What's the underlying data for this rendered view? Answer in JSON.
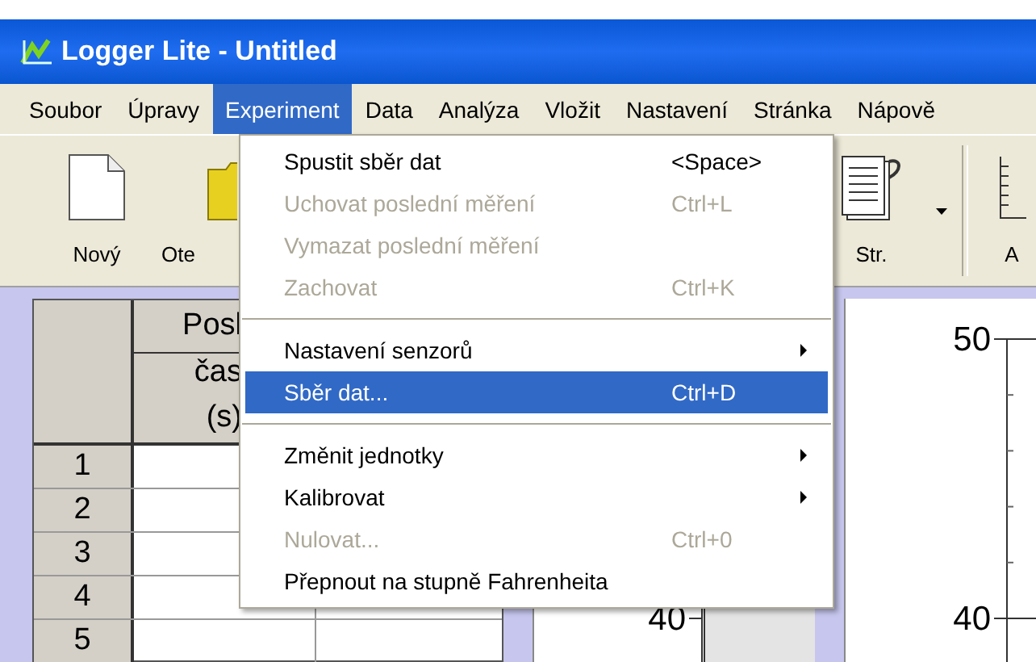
{
  "window": {
    "title": "Logger Lite - Untitled"
  },
  "menu_bar": [
    {
      "label": "Soubor",
      "selected": false
    },
    {
      "label": "Úpravy",
      "selected": false
    },
    {
      "label": "Experiment",
      "selected": true
    },
    {
      "label": "Data",
      "selected": false
    },
    {
      "label": "Analýza",
      "selected": false
    },
    {
      "label": "Vložit",
      "selected": false
    },
    {
      "label": "Nastavení",
      "selected": false
    },
    {
      "label": "Stránka",
      "selected": false
    },
    {
      "label": "Nápově",
      "selected": false
    }
  ],
  "toolbar": [
    {
      "label": "Nový",
      "has_dropdown": false
    },
    {
      "label": "Ote",
      "has_dropdown": false
    },
    {
      "label": "Str.",
      "has_dropdown": true
    },
    {
      "label": "A",
      "has_dropdown": false
    }
  ],
  "table": {
    "column_group": "Posl",
    "column": "čas",
    "unit": "(s)",
    "rows": [
      "1",
      "2",
      "3",
      "4",
      "5"
    ]
  },
  "graphs": [
    {
      "ticks": [
        "40"
      ]
    },
    {
      "ticks": [
        "50",
        "40"
      ]
    }
  ],
  "menu": [
    {
      "kind": "item",
      "label": "Spustit sběr dat",
      "shortcut": "<Space>",
      "disabled": false,
      "selected": false,
      "submenu": false
    },
    {
      "kind": "item",
      "label": "Uchovat poslední měření",
      "shortcut": "Ctrl+L",
      "disabled": true,
      "selected": false,
      "submenu": false
    },
    {
      "kind": "item",
      "label": "Vymazat poslední měření",
      "disabled": true,
      "selected": false,
      "submenu": false
    },
    {
      "kind": "item",
      "label": "Zachovat",
      "shortcut": "Ctrl+K",
      "disabled": true,
      "selected": false,
      "submenu": false
    },
    {
      "kind": "separator"
    },
    {
      "kind": "item",
      "label": "Nastavení senzorů",
      "disabled": false,
      "selected": false,
      "submenu": true
    },
    {
      "kind": "item",
      "label": "Sběr dat...",
      "shortcut": "Ctrl+D",
      "disabled": false,
      "selected": true,
      "submenu": false
    },
    {
      "kind": "separator"
    },
    {
      "kind": "item",
      "label": "Změnit jednotky",
      "disabled": false,
      "selected": false,
      "submenu": true
    },
    {
      "kind": "item",
      "label": "Kalibrovat",
      "disabled": false,
      "selected": false,
      "submenu": true
    },
    {
      "kind": "item",
      "label": "Nulovat...",
      "shortcut": "Ctrl+0",
      "disabled": true,
      "selected": false,
      "submenu": false
    },
    {
      "kind": "item",
      "label": "Přepnout na stupně Fahrenheita",
      "disabled": false,
      "selected": false,
      "submenu": false
    }
  ]
}
